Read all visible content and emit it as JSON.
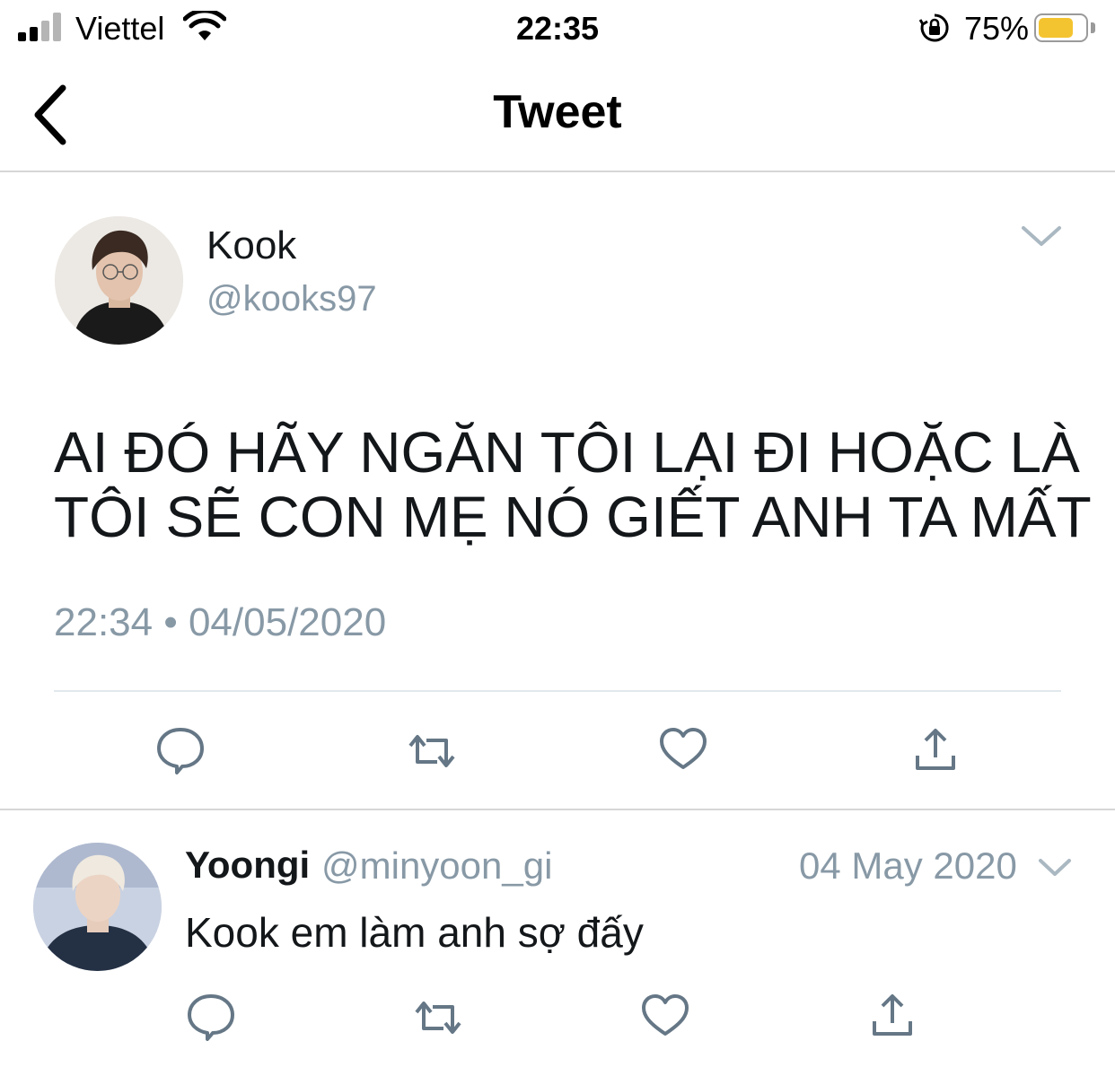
{
  "status_bar": {
    "carrier": "Viettel",
    "time": "22:35",
    "battery_percent": "75%",
    "battery_level": 0.75,
    "battery_color": "#f4c430",
    "icons": [
      "signal-icon",
      "wifi-icon",
      "orientation-lock-icon",
      "battery-icon"
    ]
  },
  "nav": {
    "title": "Tweet",
    "back_icon": "chevron-left-icon"
  },
  "tweet": {
    "display_name": "Kook",
    "handle": "@kooks97",
    "text": "AI ĐÓ HÃY NGĂN TÔI LẠI ĐI HOẶC LÀ TÔI SẼ CON MẸ NÓ GIẾT ANH TA MẤT",
    "timestamp": "22:34 • 04/05/2020",
    "actions": [
      "reply-icon",
      "retweet-icon",
      "like-icon",
      "share-icon"
    ]
  },
  "reply": {
    "display_name": "Yoongi",
    "handle": "@minyoon_gi",
    "date": "04 May 2020",
    "text": "Kook em làm anh sợ đấy",
    "actions": [
      "reply-icon",
      "retweet-icon",
      "like-icon",
      "share-icon"
    ]
  },
  "colors": {
    "text_primary": "#14171a",
    "text_secondary": "#8899a6",
    "icon_gray": "#657786",
    "divider": "#e1e8ed"
  }
}
